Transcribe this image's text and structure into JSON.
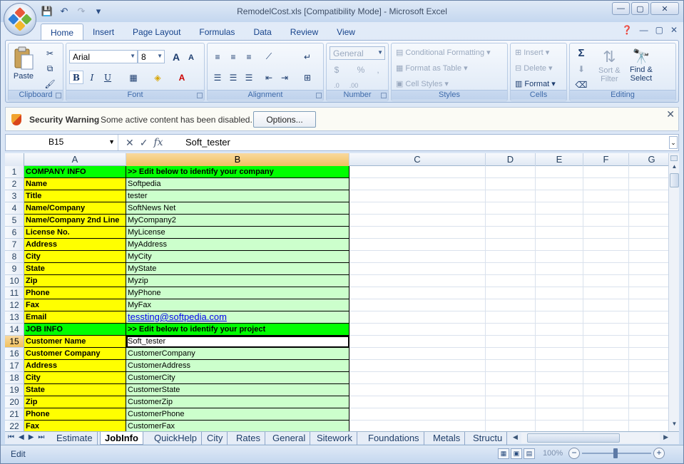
{
  "window": {
    "title": "RemodelCost.xls  [Compatibility Mode] - Microsoft Excel",
    "controls": {
      "minimize": "—",
      "maximize": "▢",
      "close": "✕"
    }
  },
  "qat": {
    "save": "💾",
    "undo": "↶",
    "redo": "↷",
    "more": "▾"
  },
  "tabs": [
    "Home",
    "Insert",
    "Page Layout",
    "Formulas",
    "Data",
    "Review",
    "View"
  ],
  "active_tab": "Home",
  "ribbon": {
    "clipboard": {
      "label": "Clipboard",
      "paste": "Paste"
    },
    "font": {
      "label": "Font",
      "family": "Arial",
      "size": "8",
      "bold": "B",
      "italic": "I",
      "underline": "U",
      "grow": "A",
      "shrink": "A"
    },
    "alignment": {
      "label": "Alignment"
    },
    "number": {
      "label": "Number",
      "format": "General",
      "currency": "$",
      "percent": "%",
      "comma": ","
    },
    "styles": {
      "label": "Styles",
      "conditional": "Conditional Formatting",
      "format_table": "Format as Table",
      "cell_styles": "Cell Styles"
    },
    "cells": {
      "label": "Cells",
      "insert": "Insert",
      "delete": "Delete",
      "format": "Format"
    },
    "editing": {
      "label": "Editing",
      "sort": "Sort &",
      "filter": "Filter",
      "find": "Find &",
      "select": "Select"
    }
  },
  "security": {
    "title": "Security Warning",
    "message": "Some active content has been disabled.",
    "options_button": "Options..."
  },
  "formula_bar": {
    "name_box": "B15",
    "fx": "fx",
    "value": "Soft_tester"
  },
  "columns": [
    "A",
    "B",
    "C",
    "D",
    "E",
    "F",
    "G"
  ],
  "rows": [
    {
      "num": "1",
      "a": "COMPANY INFO",
      "b": ">> Edit below to identify your company",
      "type": "head"
    },
    {
      "num": "2",
      "a": "Name",
      "b": "Softpedia"
    },
    {
      "num": "3",
      "a": "Title",
      "b": "tester"
    },
    {
      "num": "4",
      "a": "Name/Company",
      "b": "SoftNews Net"
    },
    {
      "num": "5",
      "a": "Name/Company 2nd Line",
      "b": "MyCompany2"
    },
    {
      "num": "6",
      "a": "License No.",
      "b": "MyLicense"
    },
    {
      "num": "7",
      "a": "Address",
      "b": "MyAddress"
    },
    {
      "num": "8",
      "a": "City",
      "b": "MyCity"
    },
    {
      "num": "9",
      "a": "State",
      "b": "MyState"
    },
    {
      "num": "10",
      "a": "Zip",
      "b": "Myzip"
    },
    {
      "num": "11",
      "a": "Phone",
      "b": "MyPhone"
    },
    {
      "num": "12",
      "a": "Fax",
      "b": "MyFax"
    },
    {
      "num": "13",
      "a": "Email",
      "b": "tessting@softpedia.com",
      "type": "link"
    },
    {
      "num": "14",
      "a": "JOB INFO",
      "b": ">> Edit below to identify your project",
      "type": "head"
    },
    {
      "num": "15",
      "a": "Customer Name",
      "b": "Soft_tester",
      "type": "active"
    },
    {
      "num": "16",
      "a": "Customer Company",
      "b": "CustomerCompany"
    },
    {
      "num": "17",
      "a": "Address",
      "b": "CustomerAddress"
    },
    {
      "num": "18",
      "a": "City",
      "b": "CustomerCity"
    },
    {
      "num": "19",
      "a": "State",
      "b": "CustomerState"
    },
    {
      "num": "20",
      "a": "Zip",
      "b": "CustomerZip"
    },
    {
      "num": "21",
      "a": "Phone",
      "b": "CustomerPhone"
    },
    {
      "num": "22",
      "a": "Fax",
      "b": "CustomerFax"
    }
  ],
  "sheets": [
    "Estimate",
    "JobInfo",
    "QuickHelp",
    "City",
    "Rates",
    "General",
    "Sitework",
    "Foundations",
    "Metals",
    "Structu"
  ],
  "active_sheet": "JobInfo",
  "status": {
    "mode": "Edit",
    "zoom": "100%"
  },
  "colors": {
    "label_fill": "#ffff00",
    "value_fill": "#ccffcc",
    "header_fill": "#00ff00"
  }
}
